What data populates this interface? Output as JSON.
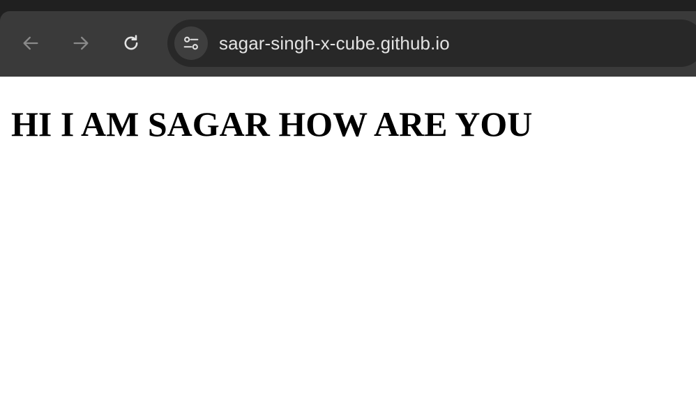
{
  "browser": {
    "url": "sagar-singh-x-cube.github.io",
    "icons": {
      "back": "arrow-left-icon",
      "forward": "arrow-right-icon",
      "reload": "reload-icon",
      "site_info": "tune-icon"
    },
    "colors": {
      "chrome_bg": "#202020",
      "toolbar_bg": "#3a3a3a",
      "omnibox_bg": "#282828",
      "url_text": "#e3e3e3"
    }
  },
  "page": {
    "heading": "HI I AM SAGAR HOW ARE YOU",
    "colors": {
      "background": "#ffffff",
      "text": "#000000"
    }
  }
}
